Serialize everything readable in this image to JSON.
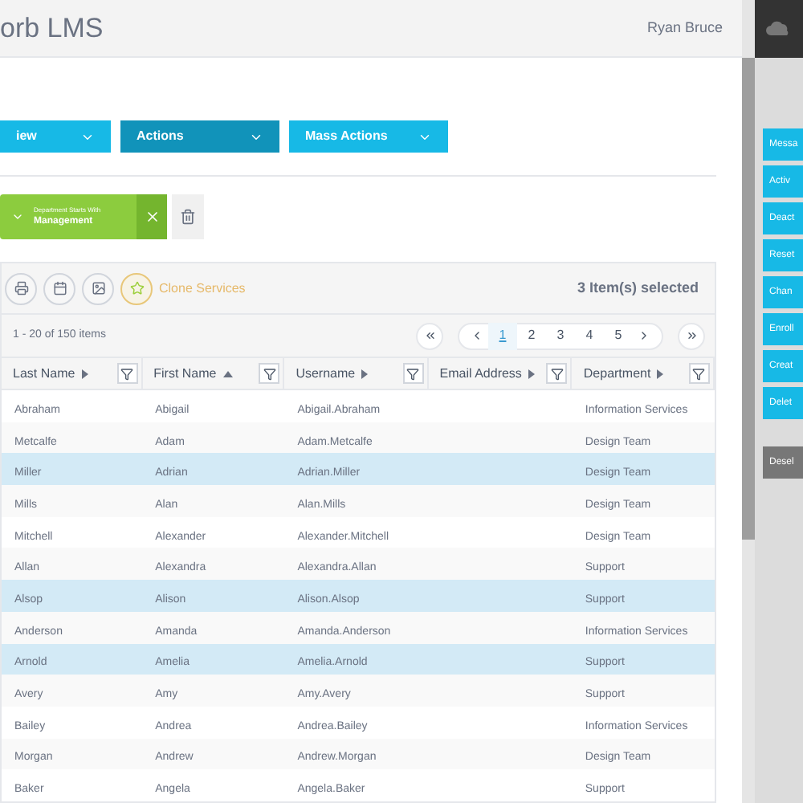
{
  "header": {
    "title": "orb LMS",
    "user": "Ryan Bruce"
  },
  "dropdowns": [
    {
      "label": "iew",
      "active": false
    },
    {
      "label": "Actions",
      "active": true
    },
    {
      "label": "Mass Actions",
      "active": false
    }
  ],
  "filter": {
    "field": "Department Starts With",
    "value": "Management"
  },
  "toolbar": {
    "clone_label": "Clone Services",
    "selection": "3 Item(s) selected"
  },
  "pager": {
    "summary": "1 - 20 of 150 items",
    "pages": [
      {
        "label": "1",
        "selected": true
      },
      {
        "label": "2",
        "selected": false
      },
      {
        "label": "3",
        "selected": false
      },
      {
        "label": "4",
        "selected": false
      },
      {
        "label": "5",
        "selected": false
      }
    ]
  },
  "table": {
    "columns": [
      {
        "label": "Last Name",
        "sorted_ascending": false
      },
      {
        "label": "First Name",
        "sorted_ascending": true
      },
      {
        "label": "Username",
        "sorted_ascending": false
      },
      {
        "label": "Email Address",
        "sorted_ascending": false
      },
      {
        "label": "Department",
        "sorted_ascending": false
      }
    ],
    "rows": [
      {
        "cells": [
          "Abraham",
          "Abigail",
          "Abigail.Abraham",
          "",
          "Information Services"
        ],
        "selected": false
      },
      {
        "cells": [
          "Metcalfe",
          "Adam",
          "Adam.Metcalfe",
          "",
          "Design Team"
        ],
        "selected": false
      },
      {
        "cells": [
          "Miller",
          "Adrian",
          "Adrian.Miller",
          "",
          "Design Team"
        ],
        "selected": true
      },
      {
        "cells": [
          "Mills",
          "Alan",
          "Alan.Mills",
          "",
          "Design Team"
        ],
        "selected": false
      },
      {
        "cells": [
          "Mitchell",
          "Alexander",
          "Alexander.Mitchell",
          "",
          "Design Team"
        ],
        "selected": false
      },
      {
        "cells": [
          "Allan",
          "Alexandra",
          "Alexandra.Allan",
          "",
          "Support"
        ],
        "selected": false
      },
      {
        "cells": [
          "Alsop",
          "Alison",
          "Alison.Alsop",
          "",
          "Support"
        ],
        "selected": true
      },
      {
        "cells": [
          "Anderson",
          "Amanda",
          "Amanda.Anderson",
          "",
          "Information Services"
        ],
        "selected": false
      },
      {
        "cells": [
          "Arnold",
          "Amelia",
          "Amelia.Arnold",
          "",
          "Support"
        ],
        "selected": true
      },
      {
        "cells": [
          "Avery",
          "Amy",
          "Amy.Avery",
          "",
          "Support"
        ],
        "selected": false
      },
      {
        "cells": [
          "Bailey",
          "Andrea",
          "Andrea.Bailey",
          "",
          "Information Services"
        ],
        "selected": false
      },
      {
        "cells": [
          "Morgan",
          "Andrew",
          "Andrew.Morgan",
          "",
          "Design Team"
        ],
        "selected": false
      },
      {
        "cells": [
          "Baker",
          "Angela",
          "Angela.Baker",
          "",
          "Support"
        ],
        "selected": false
      }
    ]
  },
  "sidebar": {
    "buttons": [
      {
        "label": "Messa",
        "kind": "action"
      },
      {
        "label": "Activ",
        "kind": "action"
      },
      {
        "label": "Deact",
        "kind": "action"
      },
      {
        "label": "Reset",
        "kind": "action"
      },
      {
        "label": "Chan",
        "kind": "action"
      },
      {
        "label": "Enroll",
        "kind": "action"
      },
      {
        "label": "Creat",
        "kind": "action"
      },
      {
        "label": "Delet",
        "kind": "action"
      },
      {
        "label": "Desel",
        "kind": "deselect"
      }
    ]
  }
}
